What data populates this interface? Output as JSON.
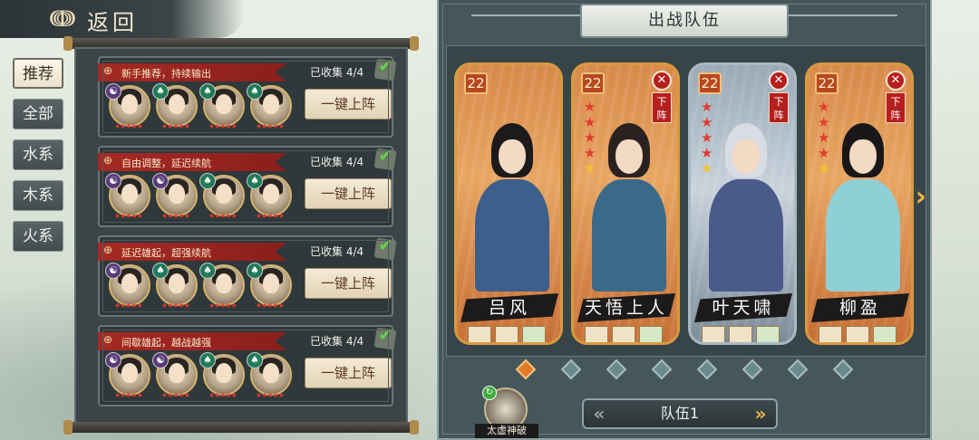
{
  "header": {
    "back_label": "返回",
    "back_icon": "cloud-swirl-icon"
  },
  "tabs": [
    {
      "label": "推荐",
      "active": true
    },
    {
      "label": "全部",
      "active": false
    },
    {
      "label": "水系",
      "active": false
    },
    {
      "label": "木系",
      "active": false
    },
    {
      "label": "火系",
      "active": false
    }
  ],
  "recommended_teams": [
    {
      "title": "新手推荐，持续输出",
      "collected": "已收集 4/4",
      "button": "一键上阵",
      "heroes": [
        {
          "element": "yin",
          "element_glyph": "☯",
          "stars": "★★★★★"
        },
        {
          "element": "wood",
          "element_glyph": "♠",
          "stars": "★★★★★"
        },
        {
          "element": "wood",
          "element_glyph": "♠",
          "stars": "★★★★★"
        },
        {
          "element": "wood",
          "element_glyph": "♠",
          "stars": "★★★★★"
        }
      ]
    },
    {
      "title": "自由调整，延迟续航",
      "collected": "已收集 4/4",
      "button": "一键上阵",
      "heroes": [
        {
          "element": "yin",
          "element_glyph": "☯",
          "stars": "★★★★★"
        },
        {
          "element": "yin",
          "element_glyph": "☯",
          "stars": "★★★★★"
        },
        {
          "element": "wood",
          "element_glyph": "♠",
          "stars": "★★★★★"
        },
        {
          "element": "wood",
          "element_glyph": "♠",
          "stars": "★★★★★"
        }
      ]
    },
    {
      "title": "延迟雄起，超强续航",
      "collected": "已收集 4/4",
      "button": "一键上阵",
      "heroes": [
        {
          "element": "yin",
          "element_glyph": "☯",
          "stars": "★★★★★"
        },
        {
          "element": "wood",
          "element_glyph": "♠",
          "stars": "★★★★★"
        },
        {
          "element": "wood",
          "element_glyph": "♠",
          "stars": "★★★★★"
        },
        {
          "element": "wood",
          "element_glyph": "♠",
          "stars": "★★★★★"
        }
      ]
    },
    {
      "title": "间歇雄起，越战越强",
      "collected": "已收集 4/4",
      "button": "一键上阵",
      "heroes": [
        {
          "element": "yin",
          "element_glyph": "☯",
          "stars": "★★★★★"
        },
        {
          "element": "yin",
          "element_glyph": "☯",
          "stars": "★★★★★"
        },
        {
          "element": "wood",
          "element_glyph": "♠",
          "stars": "★★★★★"
        },
        {
          "element": "wood",
          "element_glyph": "♠",
          "stars": "★★★★★"
        }
      ]
    }
  ],
  "deployment": {
    "title": "出战队伍",
    "team_label": "队伍1",
    "remove_label": "下阵",
    "skill_label": "太虚神破",
    "page_count": 8,
    "active_page": 0,
    "heroes": [
      {
        "name": "吕风",
        "level": "22",
        "red_stars": 0,
        "gold_stars": 0,
        "removable": false,
        "frame": "gold",
        "hair": "#1d1a1b",
        "robe": "#3c5f8c"
      },
      {
        "name": "天悟上人",
        "level": "22",
        "red_stars": 4,
        "gold_stars": 1,
        "removable": true,
        "frame": "gold",
        "hair": "#2a2220",
        "robe": "#3a6a8a"
      },
      {
        "name": "叶天啸",
        "level": "22",
        "red_stars": 4,
        "gold_stars": 1,
        "removable": true,
        "frame": "silver",
        "hair": "#d8dde4",
        "robe": "#4a5a8a"
      },
      {
        "name": "柳盈",
        "level": "22",
        "red_stars": 4,
        "gold_stars": 1,
        "removable": true,
        "frame": "gold",
        "hair": "#1a1718",
        "robe": "#8fd0d6"
      }
    ]
  }
}
